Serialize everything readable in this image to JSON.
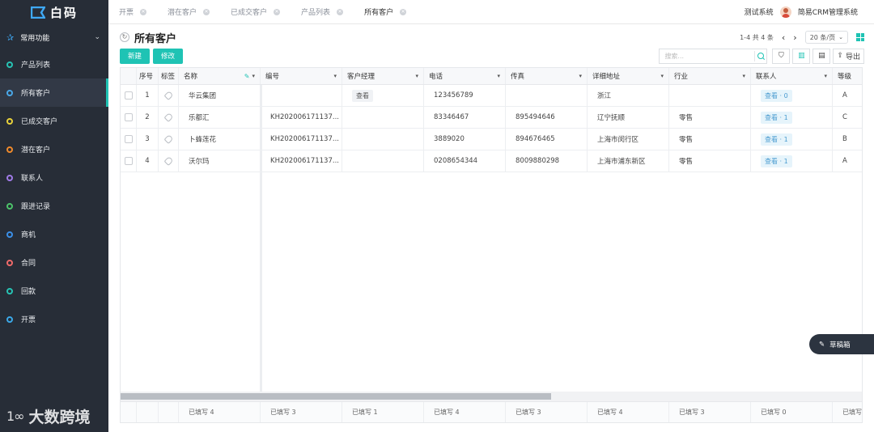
{
  "app": {
    "logo_text": "白码"
  },
  "sidebar": {
    "group_label": "常用功能",
    "items": [
      {
        "label": "产品列表",
        "color": "#27c3b4",
        "active": false
      },
      {
        "label": "所有客户",
        "color": "#4aa8e8",
        "active": true
      },
      {
        "label": "已成交客户",
        "color": "#e8d23b",
        "active": false
      },
      {
        "label": "潜在客户",
        "color": "#f08a2b",
        "active": false
      },
      {
        "label": "联系人",
        "color": "#a07be8",
        "active": false
      },
      {
        "label": "跟进记录",
        "color": "#4cc36a",
        "active": false
      },
      {
        "label": "商机",
        "color": "#3b8fe8",
        "active": false
      },
      {
        "label": "合同",
        "color": "#ef6a6a",
        "active": false
      },
      {
        "label": "回款",
        "color": "#27c3b4",
        "active": false
      },
      {
        "label": "开票",
        "color": "#3ba8e8",
        "active": false
      }
    ]
  },
  "watermark": {
    "mark": "1∞",
    "text": "大数跨境"
  },
  "tabs": [
    "开票",
    "潜在客户",
    "已成交客户",
    "产品列表",
    "所有客户"
  ],
  "header_right": {
    "system": "测试系统",
    "account": "简易CRM管理系统"
  },
  "page": {
    "title": "所有客户",
    "pager_text": "1-4 共 4 条",
    "page_size": "20 条/页"
  },
  "toolbar": {
    "new_label": "新建",
    "edit_label": "修改",
    "search_placeholder": "搜索...",
    "export_label": "导出"
  },
  "table": {
    "columns": [
      "序号",
      "标签",
      "名称",
      "编号",
      "客户经理",
      "电话",
      "传真",
      "详细地址",
      "行业",
      "联系人",
      "等级"
    ],
    "rows": [
      {
        "index": "1",
        "name": "华云集团",
        "code": "",
        "manager": "查看",
        "phone": "123456789",
        "fax": "",
        "address": "浙江",
        "industry": "",
        "contact": "查看 · 0",
        "level": "A"
      },
      {
        "index": "2",
        "name": "乐都汇",
        "code": "KH202006171137...",
        "manager": "",
        "phone": "83346467",
        "fax": "895494646",
        "address": "辽宁抚顺",
        "industry": "零售",
        "contact": "查看 · 1",
        "level": "C"
      },
      {
        "index": "3",
        "name": "卜蜂莲花",
        "code": "KH202006171137...",
        "manager": "",
        "phone": "3889020",
        "fax": "894676465",
        "address": "上海市闵行区",
        "industry": "零售",
        "contact": "查看 · 1",
        "level": "B"
      },
      {
        "index": "4",
        "name": "沃尔玛",
        "code": "KH202006171137...",
        "manager": "",
        "phone": "0208654344",
        "fax": "8009880298",
        "address": "上海市浦东新区",
        "industry": "零售",
        "contact": "查看 · 1",
        "level": "A"
      }
    ],
    "footer": [
      "已填写 4",
      "已填写 3",
      "已填写 1",
      "已填写 4",
      "已填写 3",
      "已填写 4",
      "已填写 3",
      "已填写 0",
      "已填写"
    ]
  },
  "drafts_label": "草稿箱"
}
